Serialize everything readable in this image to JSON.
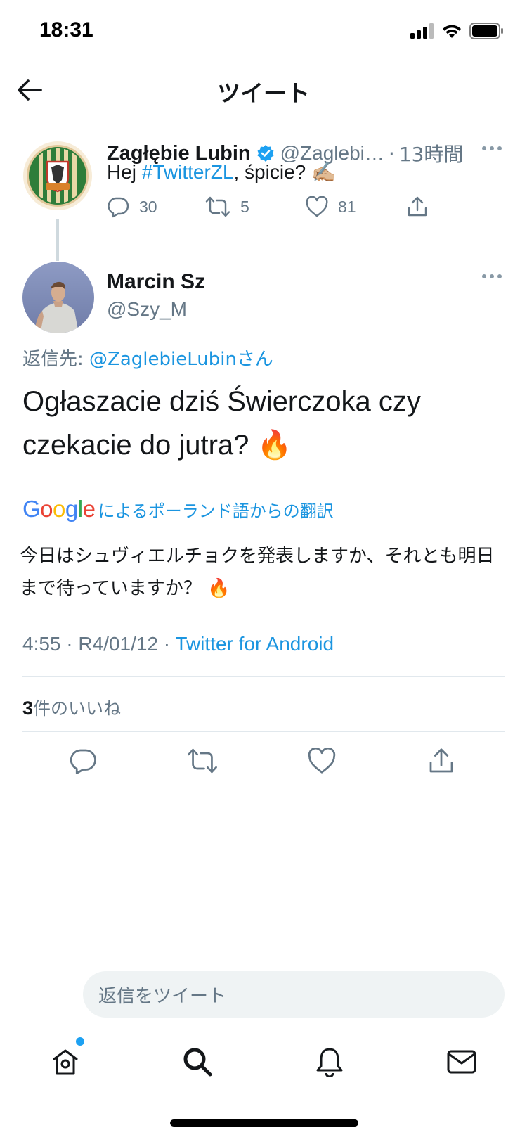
{
  "status_bar": {
    "time": "18:31"
  },
  "header": {
    "title": "ツイート"
  },
  "parent_tweet": {
    "name": "Zagłębie Lubin",
    "handle": "@Zaglebi…",
    "time": "13時間",
    "text_prefix": "Hej ",
    "hashtag": "#TwitterZL",
    "text_suffix": ", śpicie? ✍🏼",
    "replies": "30",
    "retweets": "5",
    "likes": "81"
  },
  "main_tweet": {
    "name": "Marcin Sz",
    "handle": "@Szy_M",
    "reply_label": "返信先: ",
    "reply_mention": "@ZaglebieLubinさん",
    "text": "Ogłaszacie dziś Świerczoka czy czekacie do jutra? 🔥",
    "translate_label": "によるポーランド語からの翻訳",
    "translated_text": "今日はシュヴィエルチョクを発表しますか、それとも明日まで待っていますか？ 🔥",
    "meta_time": "4:55 · R4/01/12 · ",
    "source": "Twitter for Android",
    "likes_count": "3",
    "likes_label": "件のいいね"
  },
  "reply_bar": {
    "placeholder": "返信をツイート"
  },
  "icons": {
    "back": "arrow-left-icon",
    "verified": "verified-badge-icon",
    "reply": "reply-icon",
    "retweet": "retweet-icon",
    "like": "heart-icon",
    "share": "share-icon",
    "home": "home-icon",
    "search": "search-icon",
    "notifications": "bell-icon",
    "messages": "mail-icon"
  },
  "colors": {
    "accent": "#1DA1F2",
    "link": "#1B95E0",
    "secondary": "#657786"
  }
}
